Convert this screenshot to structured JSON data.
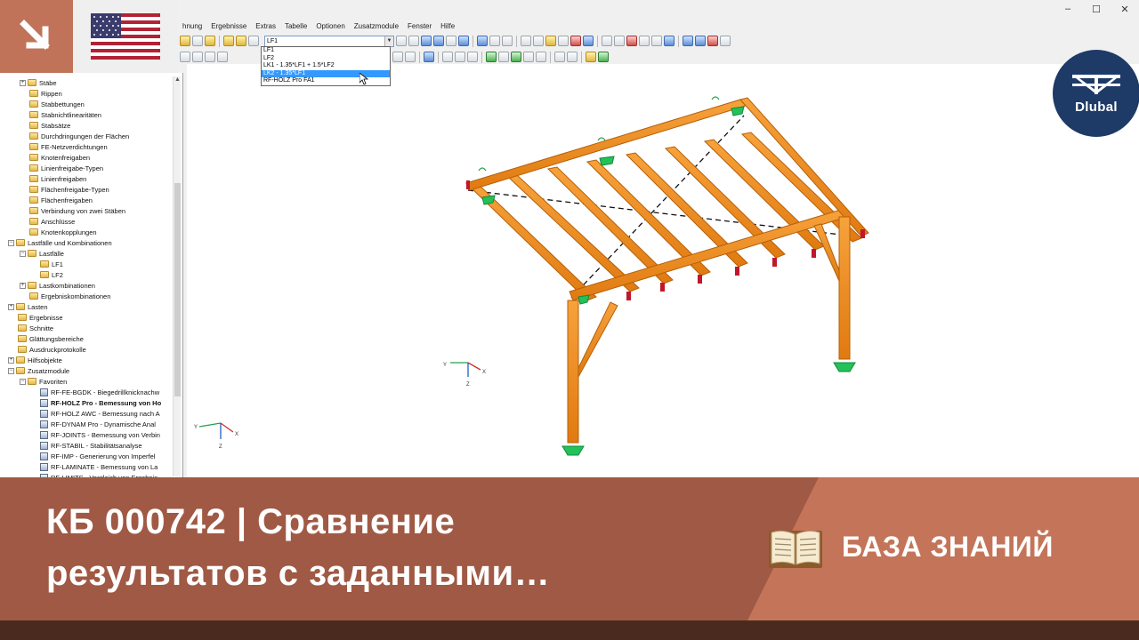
{
  "menu": [
    "hnung",
    "Ergebnisse",
    "Extras",
    "Tabelle",
    "Optionen",
    "Zusatzmodule",
    "Fenster",
    "Hilfe"
  ],
  "window_controls": [
    "–",
    "☐",
    "✕"
  ],
  "load_case_selector": {
    "current": "LF1",
    "options": [
      "LF1",
      "LF2",
      "LK1 - 1.35*LF1 + 1.5*LF2",
      "LK2 - 1.35*LF1",
      "RF-HOLZ Pro FA1"
    ],
    "highlighted_index": 3
  },
  "navigator": {
    "items": [
      {
        "label": "Stäbe",
        "level": 2,
        "expander": "+",
        "icon": "folder"
      },
      {
        "label": "Rippen",
        "level": 2,
        "icon": "folder"
      },
      {
        "label": "Stabbettungen",
        "level": 2,
        "icon": "folder"
      },
      {
        "label": "Stabnichtlinearitäten",
        "level": 2,
        "icon": "folder"
      },
      {
        "label": "Stabsätze",
        "level": 2,
        "icon": "folder"
      },
      {
        "label": "Durchdringungen der Flächen",
        "level": 2,
        "icon": "folder"
      },
      {
        "label": "FE-Netzverdichtungen",
        "level": 2,
        "icon": "folder"
      },
      {
        "label": "Knotenfreigaben",
        "level": 2,
        "icon": "folder"
      },
      {
        "label": "Linienfreigabe-Typen",
        "level": 2,
        "icon": "folder"
      },
      {
        "label": "Linienfreigaben",
        "level": 2,
        "icon": "folder"
      },
      {
        "label": "Flächenfreigabe-Typen",
        "level": 2,
        "icon": "folder"
      },
      {
        "label": "Flächenfreigaben",
        "level": 2,
        "icon": "folder"
      },
      {
        "label": "Verbindung von zwei Stäben",
        "level": 2,
        "icon": "folder"
      },
      {
        "label": "Anschlüsse",
        "level": 2,
        "icon": "folder"
      },
      {
        "label": "Knotenkopplungen",
        "level": 2,
        "icon": "folder"
      },
      {
        "label": "Lastfälle und Kombinationen",
        "level": 1,
        "expander": "−",
        "icon": "folder"
      },
      {
        "label": "Lastfälle",
        "level": 2,
        "expander": "−",
        "icon": "folder"
      },
      {
        "label": "LF1",
        "level": 3,
        "icon": "folder"
      },
      {
        "label": "LF2",
        "level": 3,
        "icon": "folder"
      },
      {
        "label": "Lastkombinationen",
        "level": 2,
        "expander": "+",
        "icon": "folder"
      },
      {
        "label": "Ergebniskombinationen",
        "level": 2,
        "icon": "folder"
      },
      {
        "label": "Lasten",
        "level": 1,
        "expander": "+",
        "icon": "folder"
      },
      {
        "label": "Ergebnisse",
        "level": 1,
        "icon": "folder"
      },
      {
        "label": "Schnitte",
        "level": 1,
        "icon": "folder"
      },
      {
        "label": "Glättungsbereiche",
        "level": 1,
        "icon": "folder"
      },
      {
        "label": "Ausdruckprotokolle",
        "level": 1,
        "icon": "folder"
      },
      {
        "label": "Hilfsobjekte",
        "level": 1,
        "expander": "+",
        "icon": "folder"
      },
      {
        "label": "Zusatzmodule",
        "level": 1,
        "expander": "−",
        "icon": "folder"
      },
      {
        "label": "Favoriten",
        "level": 2,
        "expander": "−",
        "icon": "folder"
      },
      {
        "label": "RF-FE-BGDK - Biegedrillknicknachw",
        "level": 3,
        "icon": "module"
      },
      {
        "label": "RF-HOLZ Pro - Bemessung von Ho",
        "level": 3,
        "icon": "module",
        "bold": true
      },
      {
        "label": "RF-HOLZ AWC - Bemessung nach A",
        "level": 3,
        "icon": "module"
      },
      {
        "label": "RF-DYNAM Pro - Dynamische Anal",
        "level": 3,
        "icon": "module"
      },
      {
        "label": "RF-JOINTS - Bemessung von Verbin",
        "level": 3,
        "icon": "module"
      },
      {
        "label": "RF-STABIL - Stabilitätsanalyse",
        "level": 3,
        "icon": "module"
      },
      {
        "label": "RF-IMP - Generierung von Imperfel",
        "level": 3,
        "icon": "module"
      },
      {
        "label": "RF-LAMINATE - Bemessung von La",
        "level": 3,
        "icon": "module"
      },
      {
        "label": "RF-LIMITS - Vergleich von Ergebnis",
        "level": 3,
        "icon": "module"
      }
    ]
  },
  "axes_labels": {
    "x": "X",
    "y": "Y",
    "z": "Z"
  },
  "logo_text": "Dlubal",
  "banner": {
    "title_line1": "КБ 000742 | Сравнение",
    "title_line2": "результатов с заданными…",
    "kb_label": "БАЗА ЗНАНИЙ"
  },
  "colors": {
    "banner_left": "#a05944",
    "banner_right": "#c47459",
    "timber": "#f28c1e",
    "support": "#22c15a",
    "logo_bg": "#1e3a66"
  }
}
